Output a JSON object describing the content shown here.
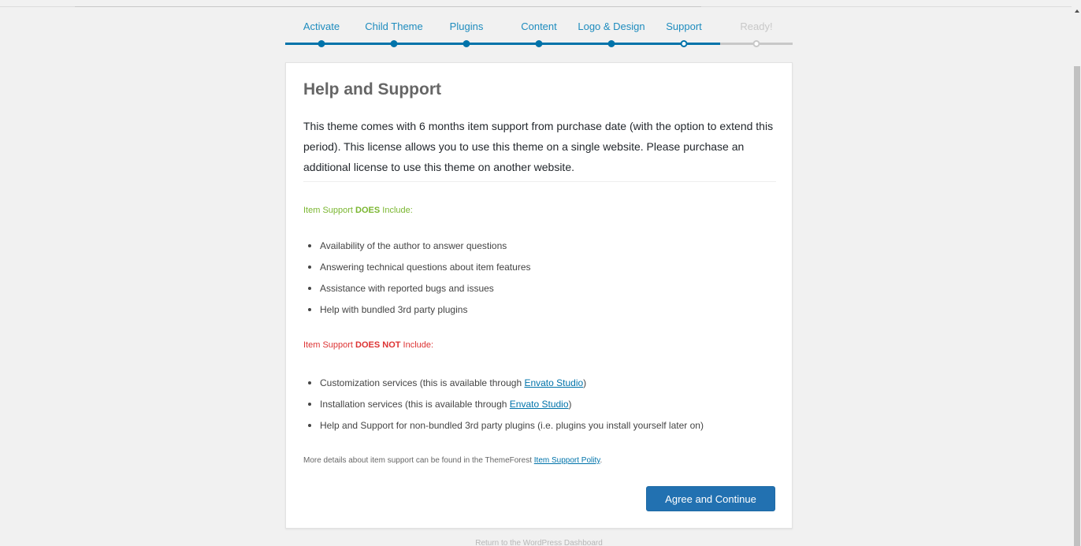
{
  "wizard": {
    "steps": [
      {
        "label": "Activate",
        "state": "done"
      },
      {
        "label": "Child Theme",
        "state": "done"
      },
      {
        "label": "Plugins",
        "state": "done"
      },
      {
        "label": "Content",
        "state": "done"
      },
      {
        "label": "Logo & Design",
        "state": "done"
      },
      {
        "label": "Support",
        "state": "current"
      },
      {
        "label": "Ready!",
        "state": "pending"
      }
    ],
    "colors": {
      "active": "#0073aa",
      "active_text": "#1e8cbe",
      "inactive": "#c8c8c8"
    }
  },
  "support": {
    "title": "Help and Support",
    "intro": "This theme comes with 6 months item support from purchase date (with the option to extend this period). This license allows you to use this theme on a single website. Please purchase an additional license to use this theme on another website.",
    "includes": {
      "prefix": "Item Support ",
      "emph": "DOES",
      "suffix": " Include:",
      "color": "#7ab630",
      "items": [
        "Availability of the author to answer questions",
        "Answering technical questions about item features",
        "Assistance with reported bugs and issues",
        "Help with bundled 3rd party plugins"
      ]
    },
    "excludes": {
      "prefix": "Item Support ",
      "emph": "DOES NOT",
      "suffix": " Include:",
      "color": "#dd3333",
      "items": [
        {
          "text": "Customization services (this is available through ",
          "link": "Envato Studio",
          "after": ")"
        },
        {
          "text": "Installation services (this is available through ",
          "link": "Envato Studio",
          "after": ")"
        },
        {
          "text": "Help and Support for non-bundled 3rd party plugins (i.e. plugins you install yourself later on)",
          "link": "",
          "after": ""
        }
      ]
    },
    "details": {
      "text": "More details about item support can be found in the ThemeForest ",
      "link": "Item Support Polity",
      "after": "."
    },
    "agree_button": "Agree and Continue",
    "button_color": "#2271b1"
  },
  "footer": {
    "dashboard_link": "Return to the WordPress Dashboard"
  }
}
